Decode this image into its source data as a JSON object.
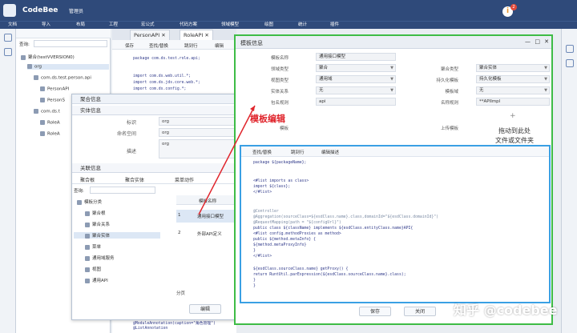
{
  "app": {
    "name": "CodeBee",
    "user": "管理员",
    "badge_count": "2"
  },
  "menu": [
    "文档",
    "导入",
    "布局",
    "工程",
    "宏公式",
    "代码方案",
    "领域模型",
    "绘图",
    "统计",
    "插件"
  ],
  "tree": {
    "query_label": "查询:",
    "items": [
      {
        "label": "聚合(testVVERSION0)"
      },
      {
        "label": "org"
      },
      {
        "label": "com.ds.test.person.api"
      },
      {
        "label": "PersonAPI"
      },
      {
        "label": "PersonS"
      },
      {
        "label": "com.ds.t"
      },
      {
        "label": "RoleA"
      },
      {
        "label": "RoleA"
      }
    ]
  },
  "editor": {
    "tabs": [
      "PersonAPI",
      "RoleAPI"
    ],
    "toolbar": [
      "保存",
      "查找/替换",
      "跳到行",
      "编辑"
    ],
    "lines": [
      "package com.ds.test.role.api;",
      "",
      "",
      "import com.ds.web.util.*;",
      "import com.ds.jds.core.web.*;",
      "import com.ds.config.*;"
    ]
  },
  "agg_panel": {
    "title": "聚合信息",
    "entity_title": "实体信息",
    "fields": [
      {
        "label": "标识",
        "value": "org"
      },
      {
        "label": "命名空间",
        "value": "org"
      },
      {
        "label": "描述",
        "value": "org"
      }
    ],
    "related_title": "关联信息",
    "tabs": [
      "聚合根",
      "聚合实体",
      "菜单动作",
      "业务模型"
    ],
    "query_label": "查询:",
    "left_tree": [
      "模板分类",
      "聚合根",
      "聚合关系",
      "聚合实体",
      "菜单",
      "通用域服务",
      "视图",
      "通用API"
    ],
    "table_header": [
      "",
      "模板名称"
    ],
    "rows": [
      {
        "num": "1",
        "name": "通用接口模型"
      },
      {
        "num": "2",
        "name": "外部API定义"
      }
    ],
    "pager": "分页",
    "edit_button": "编辑"
  },
  "modal": {
    "title": "模板信息",
    "fields": [
      {
        "label": "模板名称",
        "value": "通用接口模型"
      },
      {
        "label": "领域类型",
        "value": "聚合"
      },
      {
        "label": "视图类型",
        "value": "通用域"
      },
      {
        "label": "实体关系",
        "value": "无"
      },
      {
        "label": "包名规则",
        "value": "api"
      },
      {
        "label": "模板",
        "value": ""
      }
    ],
    "right_fields": [
      {
        "label": "聚合类型",
        "value": "聚合实体"
      },
      {
        "label": "持久化模板",
        "value": "持久化模板"
      },
      {
        "label": "模板域",
        "value": "无"
      },
      {
        "label": "名称规则",
        "value": "**APIImpl"
      },
      {
        "label": "上传模板",
        "value": ""
      }
    ],
    "annotation": "模板编辑",
    "drop_text_1": "拖动到此处",
    "drop_text_2": "文件或文件夹",
    "code_toolbar": [
      "查找/替换",
      "跳到行",
      "编辑描述"
    ],
    "code_lines": [
      "package ${packageName};",
      "",
      "",
      "<#list imports as class>",
      "import ${class};",
      "</#list>",
      "",
      "",
      "@Controller",
      "@Aggregation(sourceClass=${esdClass.name}.class,domainId=\"${esdClass.domainId}\")",
      "@RequestMapping(path = \"${configUrl}\")",
      "public class ${className}  implements ${esdClass.entityClass.name}API{",
      "    <#list config.methodProxies as method>",
      "    public   ${method.metaInfo} {",
      "          ${method.metaProxyInfo}",
      "    }",
      "  </#list>",
      "",
      "    ${esdClass.sourceClass.name} getProxy() {",
      "            return RuntUtil.parExpression(${esdClass.sourceClass.name}.class);",
      "    }",
      "}",
      ""
    ],
    "save_button": "保存",
    "close_button": "关闭"
  },
  "watermark": "知乎 @codebee",
  "bottom_code": [
    "@ModuleAnnotation(caption=\"角色管理\")",
    "@ListAnnotation"
  ]
}
